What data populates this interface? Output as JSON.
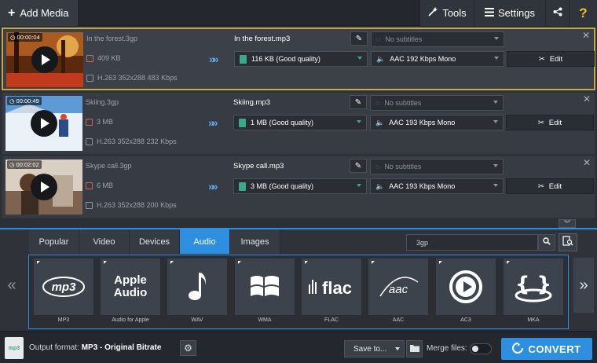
{
  "toolbar": {
    "add_media": "Add Media",
    "tools": "Tools",
    "settings": "Settings",
    "help": "?"
  },
  "files": [
    {
      "duration": "00:00:04",
      "source_name": "In the forest.3gp",
      "source_size": "409 KB",
      "source_codec": "H.263 352x288 483 Kbps",
      "output_name": "In the forest.mp3",
      "quality": "116 KB (Good quality)",
      "subtitles": "No subtitles",
      "audio": "AAC 192 Kbps Mono",
      "edit": "Edit",
      "thumb_color": "#b3541e"
    },
    {
      "duration": "00:00:49",
      "source_name": "Skiing.3gp",
      "source_size": "3 MB",
      "source_codec": "H.263 352x288 232 Kbps",
      "output_name": "Skiing.mp3",
      "quality": "1 MB (Good quality)",
      "subtitles": "No subtitles",
      "audio": "AAC 193 Kbps Mono",
      "edit": "Edit",
      "thumb_color": "#4a87c4"
    },
    {
      "duration": "00:02:02",
      "source_name": "Skype call.3gp",
      "source_size": "6 MB",
      "source_codec": "H.263 352x288 200 Kbps",
      "output_name": "Skype call.mp3",
      "quality": "3 MB (Good quality)",
      "subtitles": "No subtitles",
      "audio": "AAC 193 Kbps Mono",
      "edit": "Edit",
      "thumb_color": "#8a6c55"
    }
  ],
  "tabs": [
    "Popular",
    "Video",
    "Devices",
    "Audio",
    "Images"
  ],
  "active_tab": "Audio",
  "search": {
    "value": "3gp"
  },
  "presets": [
    {
      "label": "MP3",
      "icon": "mp3"
    },
    {
      "label": "Audio for Apple",
      "icon": "Apple Audio"
    },
    {
      "label": "WAV",
      "icon": "music-note"
    },
    {
      "label": "WMA",
      "icon": "windows"
    },
    {
      "label": "FLAC",
      "icon": "flac"
    },
    {
      "label": "AAC",
      "icon": "aac"
    },
    {
      "label": "AC3",
      "icon": "play-circle"
    },
    {
      "label": "MKA",
      "icon": "braces"
    }
  ],
  "bottom": {
    "output_label": "Output format:",
    "output_format": "MP3 - Original Bitrate",
    "badge": "mp3",
    "save_to": "Save to...",
    "merge_files": "Merge files:",
    "merge_enabled": false,
    "convert": "CONVERT"
  },
  "colors": {
    "accent": "#2e8fe0",
    "selection": "#c9a646",
    "quality_icon": "#3aa88a",
    "help": "#f6c21a"
  }
}
